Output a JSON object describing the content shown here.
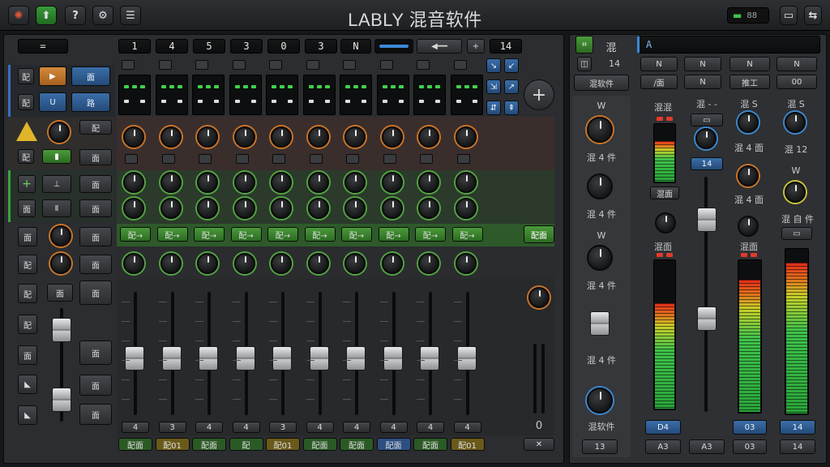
{
  "title": "LABLY 混音软件",
  "titlebar": {
    "status_label": "88",
    "icons": [
      "gear-icon",
      "upload-icon",
      "help-icon",
      "settings-icon",
      "menu-icon",
      "battery-icon",
      "screen-icon",
      "transfer-icon"
    ]
  },
  "transport": {
    "numbers": [
      "1",
      "4",
      "5",
      "3",
      "0",
      "3"
    ],
    "stepper_label": "N",
    "end_label": "14",
    "left_label": "="
  },
  "left_strip": {
    "btn_labels": [
      "配",
      "U",
      "面",
      "配",
      "路",
      "配",
      "面",
      "面",
      "配",
      "配",
      "面",
      "配",
      "面"
    ],
    "side_labels": [
      "配",
      "面",
      "面",
      "面",
      "面",
      "面",
      "面",
      "面",
      "面"
    ]
  },
  "channels": {
    "count": 11,
    "insert_labels": [
      "配→",
      "配→",
      "配→",
      "配→",
      "配→",
      "配→",
      "配→",
      "配→",
      "配→",
      "配→"
    ],
    "top_numbers": [
      "4",
      "3",
      "4",
      "4",
      "3",
      "4",
      "4",
      "4",
      "4",
      "4",
      "0"
    ],
    "bottom_labels": [
      "配面",
      "配01",
      "配面",
      "配",
      "配01",
      "配面",
      "配面",
      "配面",
      "配面",
      "配01",
      "配面"
    ],
    "fader_levels": [
      0.45,
      0.45,
      0.45,
      0.45,
      0.45,
      0.45,
      0.45,
      0.45,
      0.45,
      0.45,
      0.45
    ]
  },
  "right_top": {
    "mode_label": "混",
    "sub_label": "14",
    "name_label": "混软件",
    "field_value": "A",
    "grid_labels": [
      "N",
      "N",
      "N",
      "N",
      "/面",
      "N",
      "推工",
      "00"
    ]
  },
  "right_left_col": {
    "labels": [
      "混 4 件",
      "混 4 件",
      "混 4 件",
      "混 4 件",
      "混软件"
    ],
    "bottom_label": "13"
  },
  "right_meters": {
    "labels": [
      "混面",
      "混面",
      "混面",
      "混面"
    ],
    "bottom_values": [
      "D4",
      "A3",
      "03",
      "14"
    ],
    "top_labels": [
      "混混",
      "混 - -",
      "混 S",
      "混 S"
    ],
    "knob_labels": [
      "混 4 面",
      "混 4 面",
      "混 自 件",
      "混 12"
    ],
    "levels": [
      0.72,
      0.55,
      0.88,
      0.92
    ],
    "small_label": "14"
  },
  "colors": {
    "accent_green": "#4a9a3a",
    "accent_blue": "#3b6ea8",
    "accent_orange": "#c8742b"
  }
}
